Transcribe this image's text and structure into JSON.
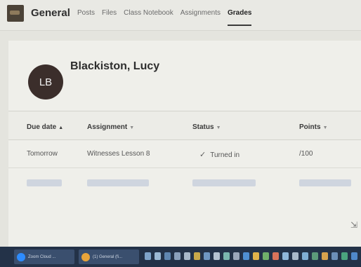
{
  "header": {
    "channel": "General",
    "tabs": [
      {
        "label": "Posts",
        "active": false
      },
      {
        "label": "Files",
        "active": false
      },
      {
        "label": "Class Notebook",
        "active": false
      },
      {
        "label": "Assignments",
        "active": false
      },
      {
        "label": "Grades",
        "active": true
      }
    ]
  },
  "student": {
    "initials": "LB",
    "name": "Blackiston, Lucy"
  },
  "table": {
    "columns": [
      "Due date",
      "Assignment",
      "Status",
      "Points"
    ],
    "rows": [
      {
        "due": "Tomorrow",
        "assignment": "Witnesses Lesson 8",
        "status": "Turned in",
        "points": "/100"
      }
    ]
  },
  "taskbar": {
    "items": [
      "Zoom Cloud ...",
      "(1) General (fi..."
    ]
  },
  "colors": {
    "taskbar": "#233248",
    "avatar": "#3b2e2b",
    "skeleton": "#cfd5df"
  }
}
